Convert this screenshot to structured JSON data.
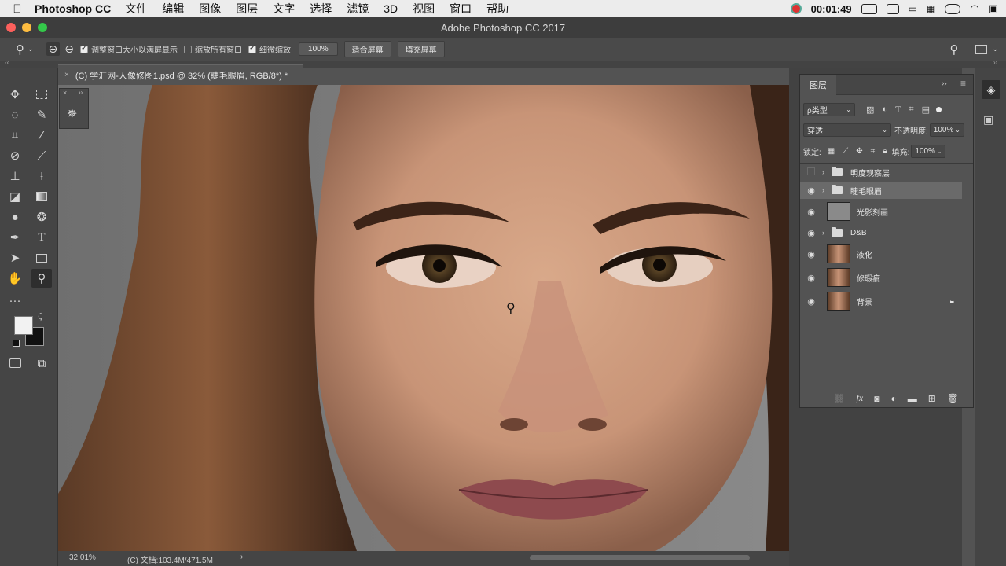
{
  "menubar": {
    "app_name": "Photoshop CC",
    "menus": [
      "文件",
      "编辑",
      "图像",
      "图层",
      "文字",
      "选择",
      "滤镜",
      "3D",
      "视图",
      "窗口",
      "帮助"
    ],
    "clock": "00:01:49"
  },
  "window": {
    "title": "Adobe Photoshop CC 2017"
  },
  "options": {
    "resize_window_label": "调整窗口大小以满屏显示",
    "zoom_all_label": "缩放所有窗口",
    "scrubby_zoom_label": "细微缩放",
    "zoom_value": "100%",
    "fit_screen_label": "适合屏幕",
    "fill_screen_label": "填充屏幕"
  },
  "document": {
    "tab_title": "(C) 学汇网-人像修图1.psd @ 32% (睫毛眼眉, RGB/8*) *"
  },
  "status": {
    "zoom": "32.01%",
    "doc_info": "(C) 文档:103.4M/471.5M"
  },
  "layers_panel": {
    "tab_label": "图层",
    "filter_kind": "ρ类型",
    "blend_mode": "穿透",
    "opacity_label": "不透明度:",
    "opacity_value": "100%",
    "lock_label": "锁定:",
    "fill_label": "填充:",
    "fill_value": "100%",
    "layers": [
      {
        "name": "明度观察层",
        "type": "group",
        "visible": false,
        "selected": false
      },
      {
        "name": "睫毛眼眉",
        "type": "group",
        "visible": true,
        "selected": true
      },
      {
        "name": "光影刻画",
        "type": "layer",
        "visible": true,
        "selected": false
      },
      {
        "name": "D&B",
        "type": "group",
        "visible": true,
        "selected": false
      },
      {
        "name": "液化",
        "type": "layer",
        "visible": true,
        "selected": false
      },
      {
        "name": "修瑕疵",
        "type": "layer",
        "visible": true,
        "selected": false
      },
      {
        "name": "背景",
        "type": "layer",
        "visible": true,
        "selected": false,
        "locked": true
      }
    ]
  },
  "colors": {
    "foreground": "#f2f2f2",
    "background": "#111111",
    "selected_layer": "#6a6a6a"
  }
}
